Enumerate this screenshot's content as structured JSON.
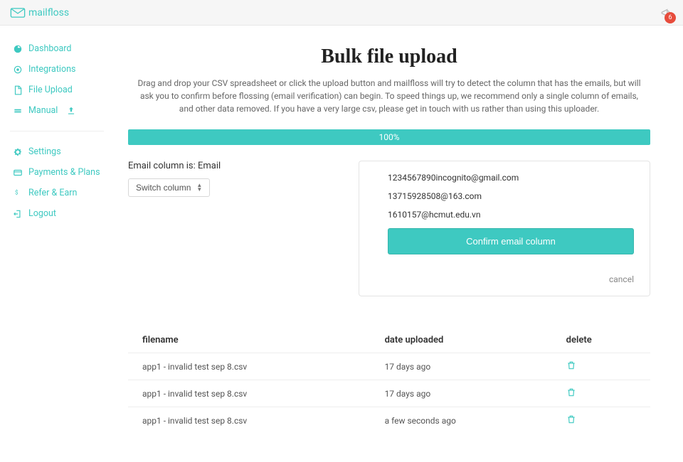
{
  "brand": {
    "name": "mailfloss"
  },
  "notifications": {
    "count": "6"
  },
  "sidebar": {
    "items": [
      {
        "label": "Dashboard",
        "icon": "dashboard-icon"
      },
      {
        "label": "Integrations",
        "icon": "integrations-icon"
      },
      {
        "label": "File Upload",
        "icon": "file-upload-icon"
      },
      {
        "label": "Manual",
        "icon": "manual-icon",
        "trailing_icon": "upload-icon"
      }
    ],
    "secondary": [
      {
        "label": "Settings",
        "icon": "gear-icon"
      },
      {
        "label": "Payments & Plans",
        "icon": "card-icon"
      },
      {
        "label": "Refer & Earn",
        "icon": "dollar-icon"
      },
      {
        "label": "Logout",
        "icon": "logout-icon"
      }
    ]
  },
  "page": {
    "title": "Bulk file upload",
    "description": "Drag and drop your CSV spreadsheet or click the upload button and mailfloss will try to detect the column that has the emails, but will ask you to confirm before flossing (email verification) can begin. To speed things up, we recommend only a single column of emails, and other data removed. If you have a very large csv, please get in touch with us rather than using this uploader."
  },
  "progress": {
    "label": "100%"
  },
  "confirmation": {
    "label_prefix": "Email column is: ",
    "column_name": "Email",
    "switch_label": "Switch column",
    "samples": [
      "1234567890incognito@gmail.com",
      "13715928508@163.com",
      "1610157@hcmut.edu.vn"
    ],
    "confirm_label": "Confirm email column",
    "cancel_label": "cancel"
  },
  "files": {
    "headers": {
      "filename": "filename",
      "date": "date uploaded",
      "delete": "delete"
    },
    "rows": [
      {
        "filename": "app1 - invalid test sep 8.csv",
        "date": "17 days ago"
      },
      {
        "filename": "app1 - invalid test sep 8.csv",
        "date": "17 days ago"
      },
      {
        "filename": "app1 - invalid test sep 8.csv",
        "date": "a few seconds ago"
      }
    ]
  },
  "colors": {
    "accent": "#3ec9c1",
    "danger": "#e74c3c"
  }
}
